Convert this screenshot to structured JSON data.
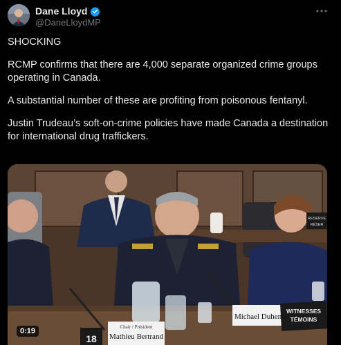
{
  "author": {
    "display_name": "Dane Lloyd",
    "handle": "@DaneLloydMP",
    "verified": true
  },
  "post": {
    "paragraphs": [
      "SHOCKING",
      "RCMP confirms that there are 4,000 separate organized crime groups operating in Canada.",
      "A substantial number of these are profiting from poisonous fentanyl.",
      "Justin Trudeau’s soft-on-crime policies have made Canada a destination for international drug traffickers."
    ]
  },
  "video": {
    "timestamp": "0:19",
    "placards": {
      "left_small": "Chair / Président",
      "left_name": "Mathieu Bertrand",
      "center_name": "Michael Duheme",
      "witnesses_en": "WITNESSES",
      "witnesses_fr": "TÉMOINS",
      "channel_number": "18",
      "reserve_en": "RESERVE",
      "reserve_fr": "RÉSER"
    }
  },
  "icons": {
    "verified": "verified-badge-icon",
    "more": "more-options-icon"
  },
  "colors": {
    "background": "#000000",
    "text": "#e7e9ea",
    "secondary": "#71767b",
    "verified": "#1d9bf0"
  }
}
